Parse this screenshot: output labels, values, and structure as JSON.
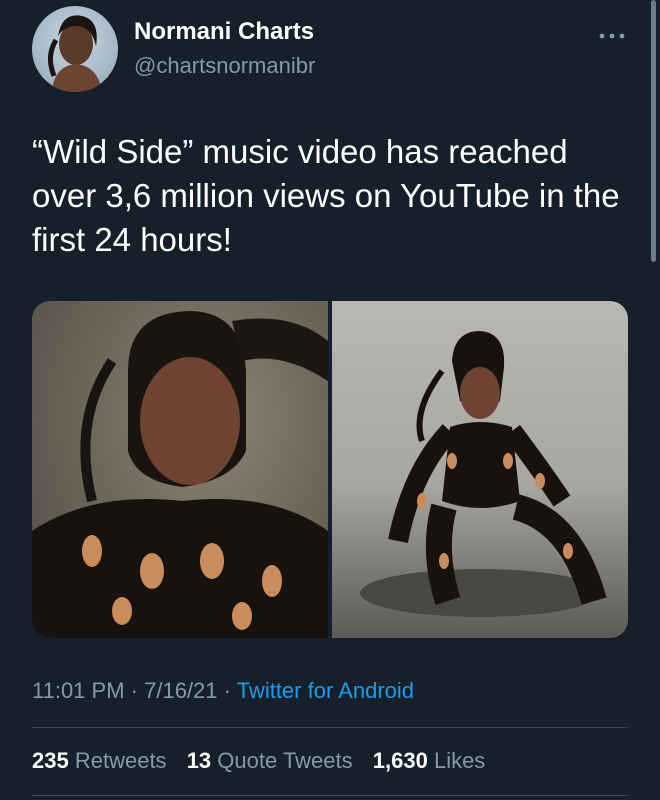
{
  "author": {
    "display_name": "Normani Charts",
    "handle": "@chartsnormanibr",
    "avatar_icon": "profile-avatar"
  },
  "more_icon": "more-dots-icon",
  "tweet": {
    "text": "“Wild Side” music video has reached over 3,6 million views on YouTube in the first 24 hours!"
  },
  "media": {
    "images": [
      {
        "icon": "photo-portrait"
      },
      {
        "icon": "photo-full-body"
      }
    ]
  },
  "meta": {
    "time": "11:01 PM",
    "sep1": "·",
    "date": "7/16/21",
    "sep2": "·",
    "source": "Twitter for Android"
  },
  "stats": {
    "retweets_count": "235",
    "retweets_label": "Retweets",
    "quotes_count": "13",
    "quotes_label": "Quote Tweets",
    "likes_count": "1,630",
    "likes_label": "Likes"
  },
  "colors": {
    "background": "#15202b",
    "text": "#ffffff",
    "secondary": "#8899a6",
    "link": "#1d9bf0",
    "divider": "#38444d"
  }
}
